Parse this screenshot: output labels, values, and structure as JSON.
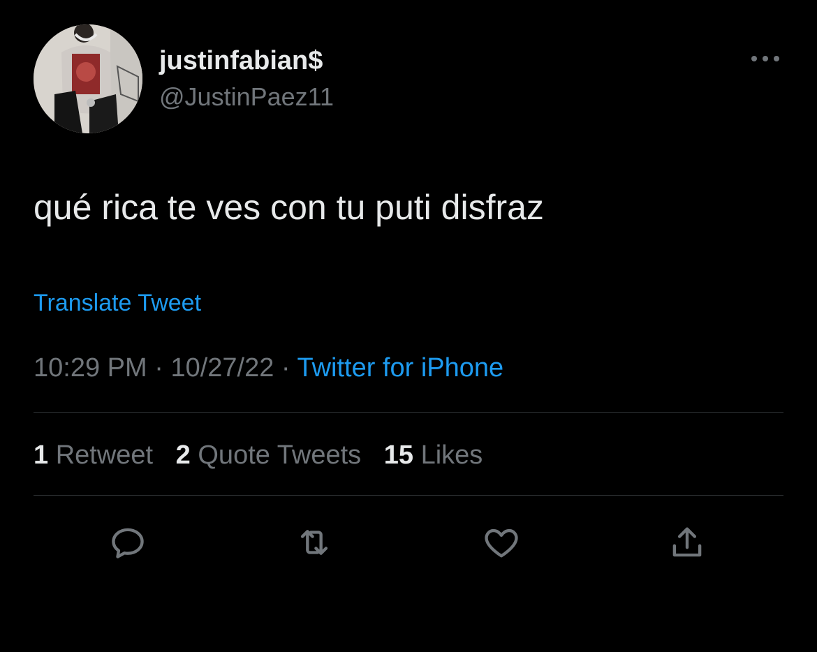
{
  "user": {
    "display_name": "justinfabian$",
    "handle": "@JustinPaez11",
    "avatar_icon": "profile-photo"
  },
  "tweet": {
    "text": "qué rica te ves con tu puti disfraz",
    "translate_label": "Translate Tweet",
    "time": "10:29 PM",
    "date": "10/27/22",
    "separator": "·",
    "source": "Twitter for iPhone"
  },
  "stats": {
    "retweets_count": "1",
    "retweets_label": "Retweet",
    "quotes_count": "2",
    "quotes_label": "Quote Tweets",
    "likes_count": "15",
    "likes_label": "Likes"
  },
  "actions": {
    "reply_icon": "reply-icon",
    "retweet_icon": "retweet-icon",
    "like_icon": "heart-icon",
    "share_icon": "share-icon",
    "more_icon": "more-icon"
  },
  "colors": {
    "background": "#000000",
    "primary_text": "#e7e9ea",
    "secondary_text": "#71767b",
    "link": "#1d9bf0",
    "divider": "#2f3336"
  }
}
